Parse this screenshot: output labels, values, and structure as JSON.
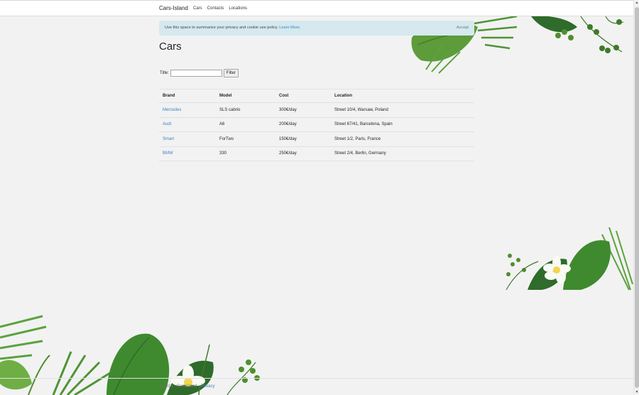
{
  "navbar": {
    "brand": "Cars-Island",
    "links": [
      "Cars",
      "Contacts",
      "Locations"
    ]
  },
  "cookie": {
    "message": "Use this space to summarize your privacy and cookie use policy.",
    "learn_more": "Learn More.",
    "accept": "Accept"
  },
  "page": {
    "title": "Cars"
  },
  "filter": {
    "label": "Title:",
    "input_value": "",
    "button": "Filter"
  },
  "table": {
    "headers": [
      "Brand",
      "Model",
      "Cost",
      "Location"
    ],
    "rows": [
      {
        "brand": "Mercedes",
        "model": "SLS cabrio",
        "cost": "300€/day",
        "location": "Street 10/4, Warsaw, Poland"
      },
      {
        "brand": "Audi",
        "model": "A6",
        "cost": "200€/day",
        "location": "Street 67/41, Barcelona, Spain"
      },
      {
        "brand": "Smart",
        "model": "ForTwo",
        "cost": "150€/day",
        "location": "Street 1/2, Paris, France"
      },
      {
        "brand": "BMW",
        "model": "330",
        "cost": "250€/day",
        "location": "Street 2/4, Berlin, Germany"
      }
    ]
  },
  "footer": {
    "text": "© 2019 - CarsIsland - ",
    "privacy": "Privacy"
  },
  "colors": {
    "link": "#3e83c6",
    "banner": "#d5e9ef",
    "background": "#f2f2f2",
    "leaf_dark": "#2f6b2a",
    "leaf_light": "#6fae45"
  }
}
